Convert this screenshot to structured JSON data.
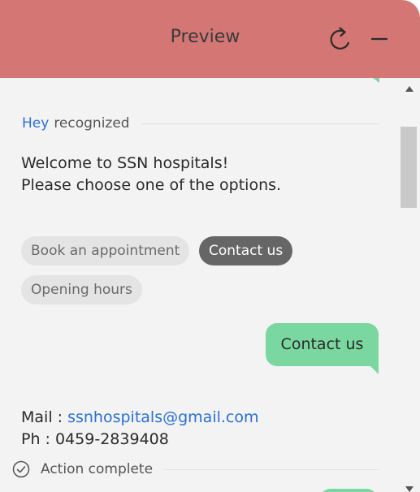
{
  "header": {
    "title": "Preview",
    "color": "#d47674"
  },
  "status": {
    "keyword": "Hey",
    "label": "recognized"
  },
  "bot_message": {
    "line1": "Welcome to SSN hospitals!",
    "line2": "Please choose one of the options."
  },
  "options": [
    {
      "label": "Book an appointment",
      "selected": false
    },
    {
      "label": "Contact us",
      "selected": true
    },
    {
      "label": "Opening hours",
      "selected": false
    }
  ],
  "user_message": "Contact us",
  "contact": {
    "mail_label": "Mail :",
    "mail_value": "ssnhospitals@gmail.com",
    "phone_label": "Ph :",
    "phone_value": "0459-2839408"
  },
  "action": {
    "label": "Action complete"
  },
  "colors": {
    "accent": "#d47674",
    "user_bubble": "#7ad7a0",
    "link": "#2a6fd8",
    "chip_selected": "#666666"
  },
  "icons": {
    "refresh": "refresh-icon",
    "minimize": "minimize-icon",
    "check": "check-circle-icon"
  }
}
